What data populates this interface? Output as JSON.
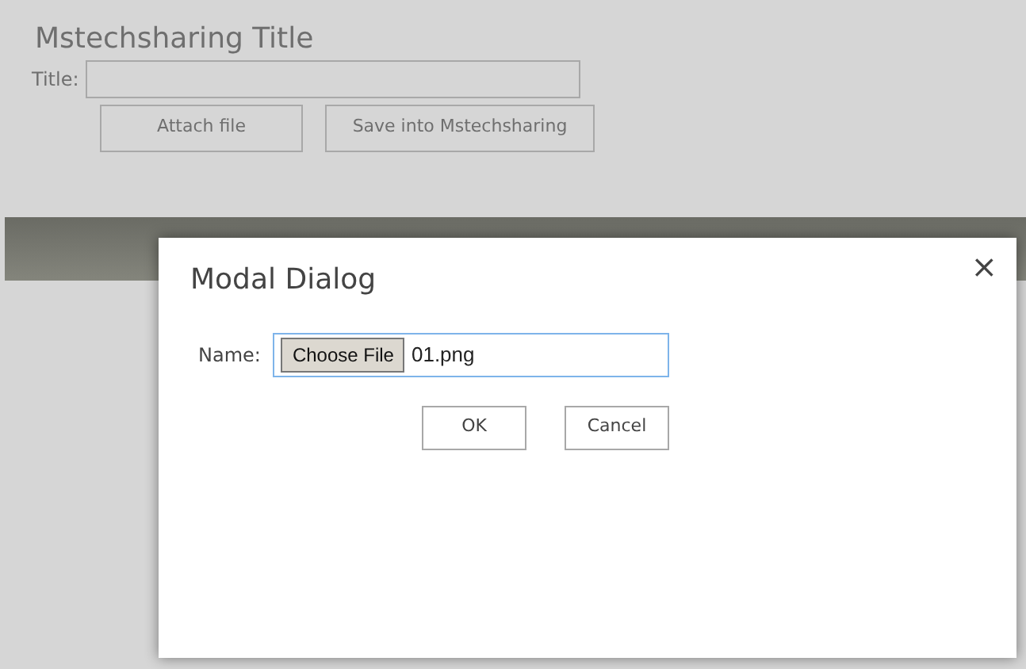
{
  "page": {
    "heading": "Mstechsharing Title",
    "title_label": "Title:",
    "buttons": [
      "Attach file",
      "Save into Mstechsharing"
    ]
  },
  "dialog": {
    "title": "Modal Dialog",
    "close": "×",
    "name_label": "Name:",
    "file_button": "Choose File",
    "file_name": "01.png",
    "buttons": [
      "OK",
      "Cancel"
    ]
  }
}
